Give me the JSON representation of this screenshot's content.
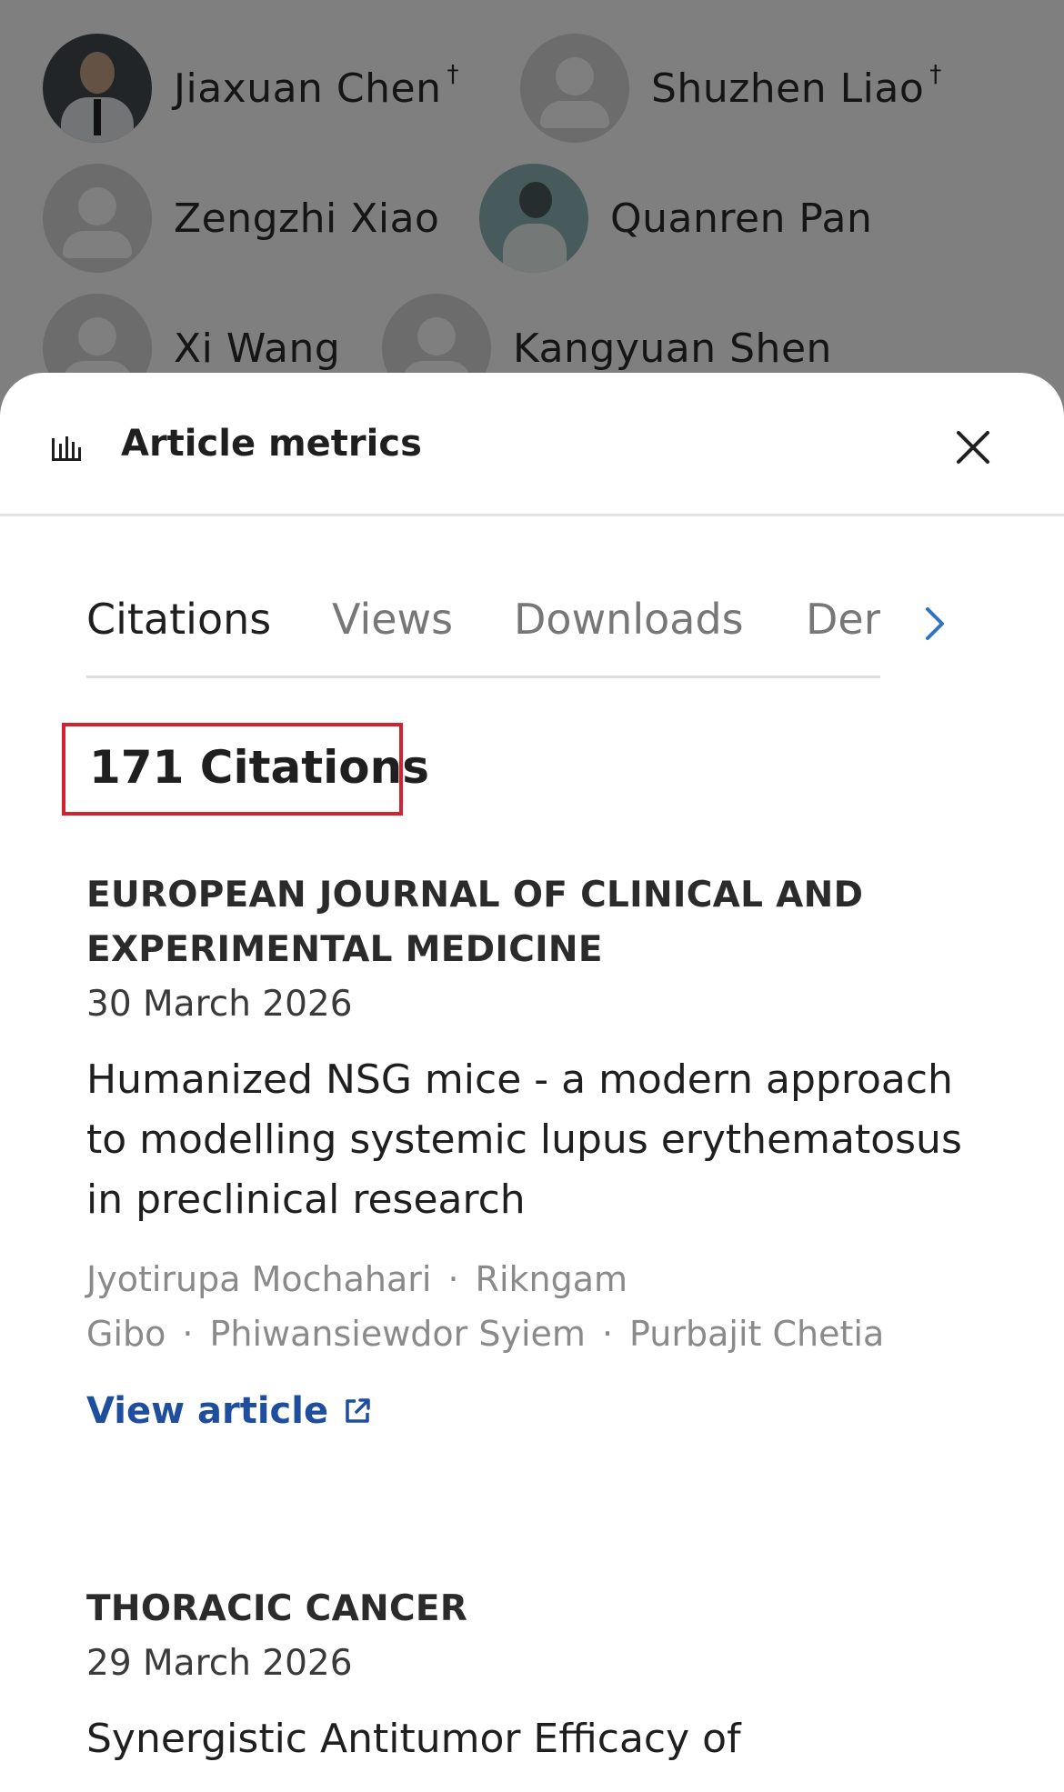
{
  "authors": [
    {
      "name": "Jiaxuan Chen",
      "mark": "†",
      "avatar": "photo"
    },
    {
      "name": "Shuzhen Liao",
      "mark": "†",
      "avatar": "placeholder"
    },
    {
      "name": "Zengzhi Xiao",
      "mark": "",
      "avatar": "placeholder"
    },
    {
      "name": "Quanren Pan",
      "mark": "",
      "avatar": "photo"
    },
    {
      "name": "Xi Wang",
      "mark": "",
      "avatar": "placeholder"
    },
    {
      "name": "Kangyuan Shen",
      "mark": "",
      "avatar": "placeholder"
    }
  ],
  "sheet": {
    "icon": "bar-chart-icon",
    "title": "Article metrics",
    "close_icon": "close-icon"
  },
  "tabs": {
    "items": [
      "Citations",
      "Views",
      "Downloads",
      "Der"
    ],
    "active": "Citations",
    "next_icon": "chevron-right-icon"
  },
  "citations": {
    "count_label": "171 Citations",
    "highlight_color": "#d1232f",
    "link_color": "#1f4e9e",
    "items": [
      {
        "journal": "EUROPEAN JOURNAL OF CLINICAL AND EXPERIMENTAL MEDICINE",
        "date": "30 March 2026",
        "title": "Humanized NSG mice - a modern approach to modelling systemic lupus erythematosus in preclinical research",
        "authors": [
          "Jyotirupa Mochahari",
          "Rikngam Gibo",
          "Phiwansiewdor Syiem",
          "Purbajit Chetia"
        ],
        "separator": "·",
        "link_label": "View article",
        "link_icon": "external-link-icon"
      },
      {
        "journal": "THORACIC CANCER",
        "date": "29 March 2026",
        "title": "Synergistic Antitumor Efficacy of"
      }
    ]
  }
}
